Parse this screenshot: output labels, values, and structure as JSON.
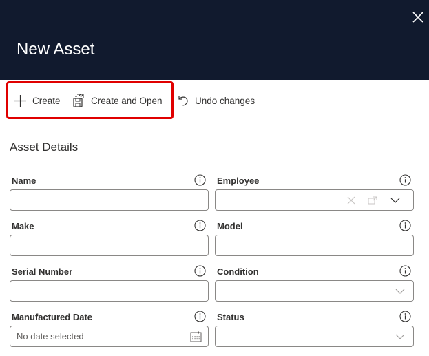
{
  "header": {
    "title": "New Asset",
    "close_icon": "close-icon"
  },
  "toolbar": {
    "create_label": "Create",
    "create_open_label": "Create and Open",
    "undo_label": "Undo changes"
  },
  "section": {
    "title": "Asset Details"
  },
  "fields": {
    "name": {
      "label": "Name",
      "value": ""
    },
    "employee": {
      "label": "Employee",
      "value": ""
    },
    "make": {
      "label": "Make",
      "value": ""
    },
    "model": {
      "label": "Model",
      "value": ""
    },
    "serial_number": {
      "label": "Serial Number",
      "value": ""
    },
    "condition": {
      "label": "Condition",
      "value": ""
    },
    "manufactured_date": {
      "label": "Manufactured Date",
      "placeholder": "No date selected"
    },
    "status": {
      "label": "Status",
      "value": ""
    }
  },
  "colors": {
    "header_bg": "#111a2e",
    "highlight": "#e00000",
    "border": "#8a8886"
  }
}
